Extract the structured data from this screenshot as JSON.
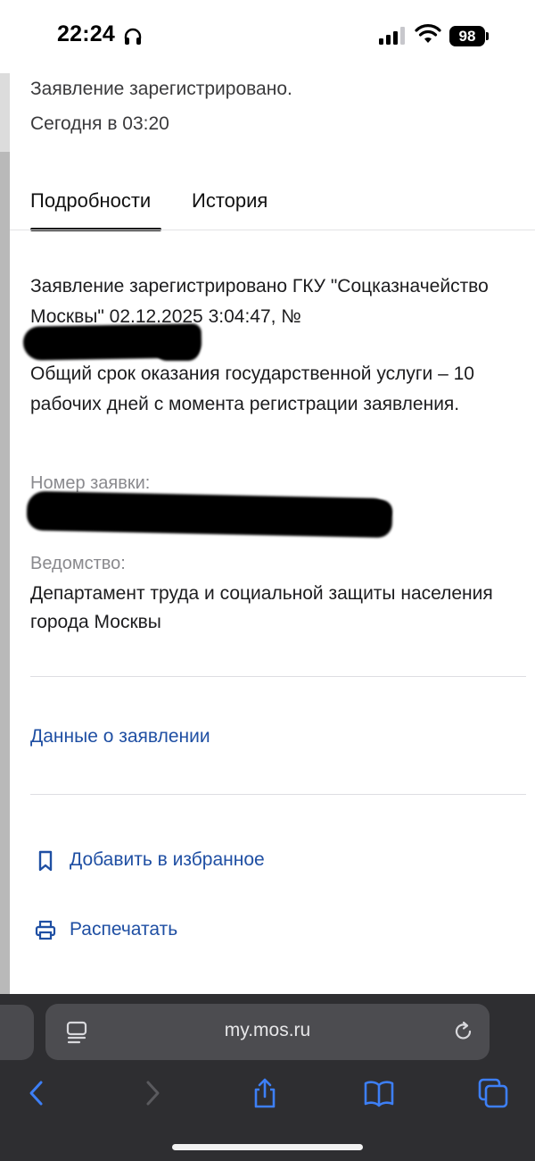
{
  "status_bar": {
    "time": "22:24",
    "battery": "98"
  },
  "header": {
    "status": "Заявление зарегистрировано.",
    "date": "Сегодня в 03:20"
  },
  "tabs": [
    {
      "label": "Подробности",
      "active": true
    },
    {
      "label": "История",
      "active": false
    }
  ],
  "details": {
    "registered_text": "Заявление зарегистрировано ГКУ \"Соцказначейство Москвы\" 02.12.2025 3:04:47, №",
    "term_text": "Общий срок оказания государственной услуги – 10 рабочих дней с момента регистрации заявления.",
    "request_number_label": "Номер заявки:",
    "department_label": "Ведомство:",
    "department_value": "Департамент труда и социальной защиты населения города Москвы"
  },
  "links": {
    "application_data": "Данные о заявлении",
    "add_favorite": "Добавить в избранное",
    "print": "Распечатать"
  },
  "browser": {
    "url": "my.mos.ru"
  },
  "colors": {
    "link": "#1f4fa3",
    "browser_bar": "#2e2e31",
    "address_bar": "#4c4c50"
  },
  "icons": {
    "favorite": "bookmark-icon",
    "print": "printer-icon",
    "back": "chevron-left-icon",
    "forward": "chevron-right-icon",
    "share": "share-icon",
    "bookmarks": "book-icon",
    "tabs": "tabs-icon"
  }
}
